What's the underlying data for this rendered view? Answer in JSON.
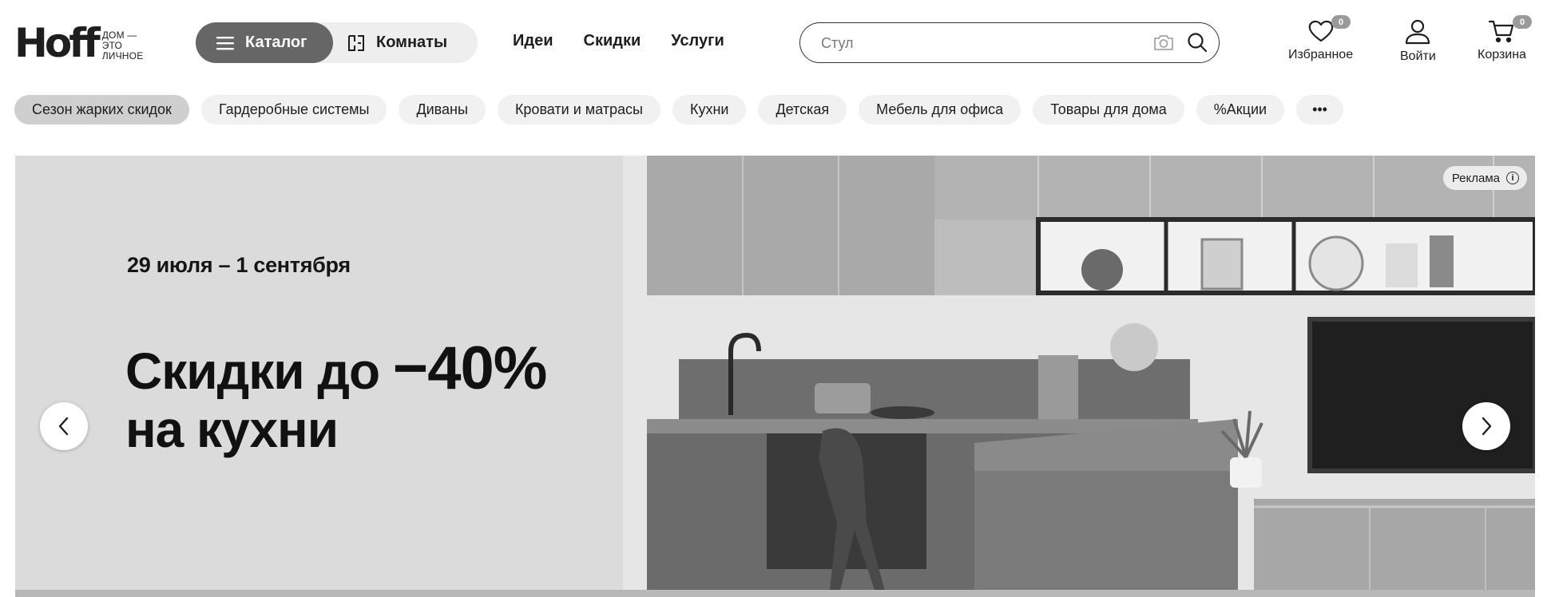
{
  "logo": {
    "mark": "Hoff",
    "tagline_line1": "дом —",
    "tagline_line2": "это личное"
  },
  "segment": {
    "catalog_label": "Каталог",
    "rooms_label": "Комнаты"
  },
  "topnav": [
    "Идеи",
    "Скидки",
    "Услуги"
  ],
  "search": {
    "placeholder": "Стул"
  },
  "actions": {
    "favorites": {
      "label": "Избранное",
      "count": "0"
    },
    "login": {
      "label": "Войти"
    },
    "cart": {
      "label": "Корзина",
      "count": "0"
    }
  },
  "chips": [
    "Сезон жарких скидок",
    "Гардеробные системы",
    "Диваны",
    "Кровати и матрасы",
    "Кухни",
    "Детская",
    "Мебель для офиса",
    "Товары для дома",
    "%Акции"
  ],
  "chips_more": "•••",
  "banner": {
    "dates": "29 июля – 1 сентября",
    "headline_part1": "Скидки до ",
    "headline_percent": "−40%",
    "headline_line2": "на кухни",
    "ad_label": "Реклама",
    "ad_info_icon": "i"
  },
  "icons": [
    "menu-icon",
    "rooms-icon",
    "camera-icon",
    "search-icon",
    "heart-icon",
    "user-icon",
    "cart-icon",
    "chevron-left-icon",
    "chevron-right-icon",
    "info-icon"
  ]
}
